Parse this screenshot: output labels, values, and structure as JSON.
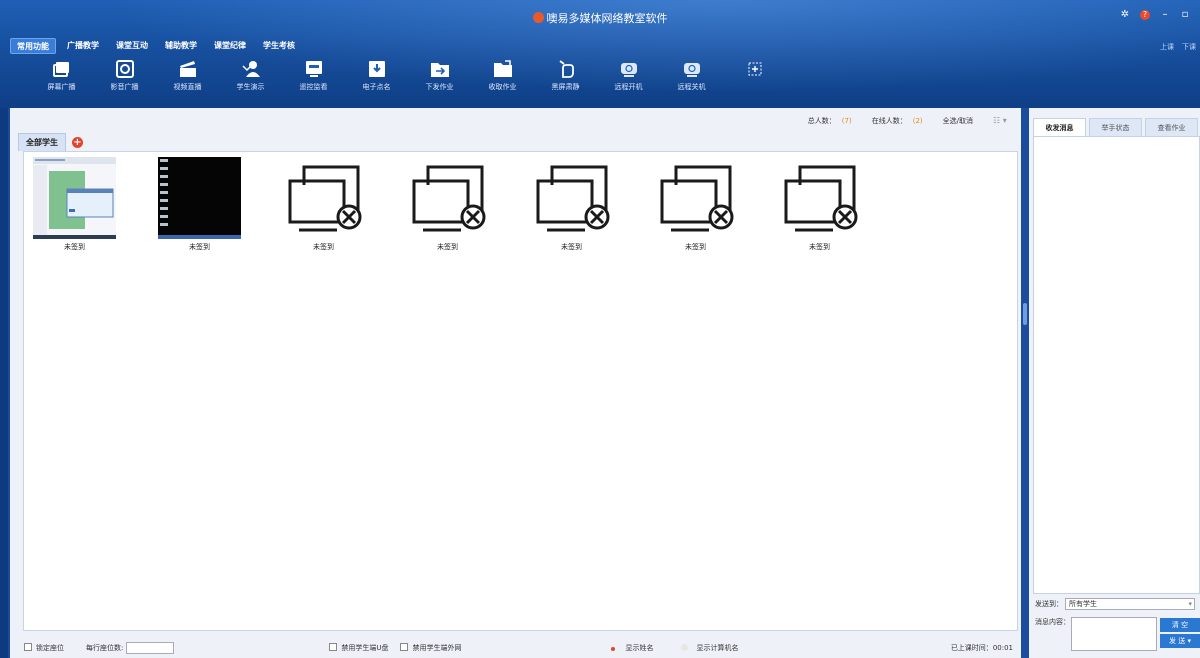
{
  "app": {
    "title": "噢易多媒体网络教室软件"
  },
  "header": {
    "login_links": [
      "上课",
      "下课"
    ],
    "menu_tabs": [
      {
        "label": "常用功能",
        "active": true
      },
      {
        "label": "广播教学",
        "active": false
      },
      {
        "label": "课堂互动",
        "active": false
      },
      {
        "label": "辅助教学",
        "active": false
      },
      {
        "label": "课堂纪律",
        "active": false
      },
      {
        "label": "学生考核",
        "active": false
      }
    ],
    "toolbar": [
      {
        "label": "屏幕广播",
        "icon": "screen-broadcast-icon"
      },
      {
        "label": "影音广播",
        "icon": "media-broadcast-icon"
      },
      {
        "label": "视频直播",
        "icon": "video-live-icon"
      },
      {
        "label": "学生演示",
        "icon": "student-demo-icon"
      },
      {
        "label": "遥控监看",
        "icon": "remote-monitor-icon"
      },
      {
        "label": "电子点名",
        "icon": "roll-call-icon"
      },
      {
        "label": "下发作业",
        "icon": "send-homework-icon"
      },
      {
        "label": "收取作业",
        "icon": "collect-homework-icon"
      },
      {
        "label": "黑屏肃静",
        "icon": "black-screen-icon"
      },
      {
        "label": "远程开机",
        "icon": "remote-power-on-icon"
      },
      {
        "label": "远程关机",
        "icon": "remote-shutdown-icon"
      },
      {
        "label": "",
        "icon": "add-tool-icon"
      }
    ]
  },
  "stats": {
    "total_label": "总人数：",
    "total_value": "(7)",
    "online_label": "在线人数：",
    "online_value": "(2)",
    "select_all": "全选/取消"
  },
  "groups": {
    "all_students": "全部学生"
  },
  "students": [
    {
      "caption": "未签到",
      "state": "online-screenshot-desktop"
    },
    {
      "caption": "未签到",
      "state": "online-screenshot-dark"
    },
    {
      "caption": "未签到",
      "state": "offline"
    },
    {
      "caption": "未签到",
      "state": "offline"
    },
    {
      "caption": "未签到",
      "state": "offline"
    },
    {
      "caption": "未签到",
      "state": "offline"
    },
    {
      "caption": "未签到",
      "state": "offline"
    }
  ],
  "bottom": {
    "lock_seat": "锁定座位",
    "seats_per_row": "每行座位数:",
    "disable_usb": "禁用学生端U盘",
    "disable_internet": "禁用学生端外网",
    "show_name": "显示姓名",
    "show_computer_name": "显示计算机名",
    "class_time_label": "已上课时间：",
    "class_time_value": "00:01"
  },
  "side": {
    "tabs": [
      {
        "label": "收发消息",
        "active": true
      },
      {
        "label": "举手状态",
        "active": false
      },
      {
        "label": "查看作业",
        "active": false
      }
    ],
    "send_to_label": "发送到：",
    "send_to_value": "所有学生",
    "content_label": "消息内容：",
    "clear_button": "清 空",
    "send_button": "发 送 ▾"
  },
  "colors": {
    "accent": "#1f5fb5",
    "count": "#e28a1c",
    "radio_on": "#e4432c"
  }
}
